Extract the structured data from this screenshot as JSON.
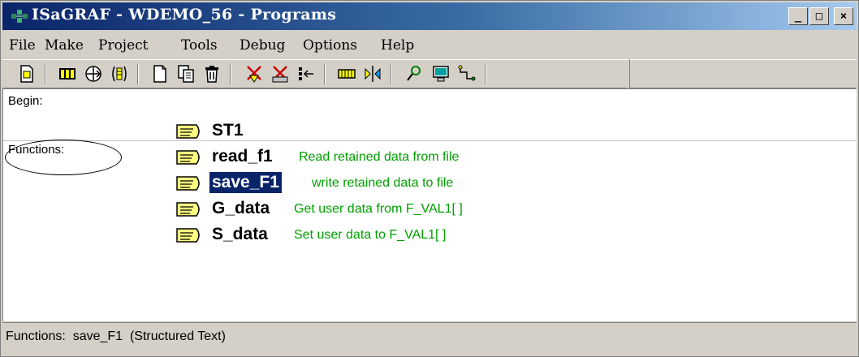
{
  "window": {
    "title": "ISaGRAF - WDEMO_56 - Programs",
    "minimize_glyph": "_",
    "maximize_glyph": "□",
    "close_glyph": "×"
  },
  "menu": [
    {
      "label": "File",
      "mnemonic": "F"
    },
    {
      "label": "Make",
      "mnemonic": "M"
    },
    {
      "label": "Project",
      "mnemonic": "P"
    },
    {
      "label": "Tools",
      "mnemonic": "T"
    },
    {
      "label": "Debug",
      "mnemonic": "b"
    },
    {
      "label": "Options",
      "mnemonic": "O"
    },
    {
      "label": "Help",
      "mnemonic": "H"
    }
  ],
  "toolbar": [
    {
      "icon": "properties-icon"
    },
    {
      "icon": "dictionary-icon"
    },
    {
      "icon": "io-connection-icon"
    },
    {
      "icon": "libraries-icon"
    },
    {
      "icon": "new-program-icon"
    },
    {
      "icon": "copy-program-icon"
    },
    {
      "icon": "delete-program-icon"
    },
    {
      "icon": "verify-icon"
    },
    {
      "icon": "compile-icon"
    },
    {
      "icon": "insert-icon"
    },
    {
      "icon": "memory-icon"
    },
    {
      "icon": "link-icon"
    },
    {
      "icon": "debug-icon"
    },
    {
      "icon": "simulate-icon"
    },
    {
      "icon": "connect-icon"
    }
  ],
  "sections": {
    "begin": {
      "label": "Begin:"
    },
    "functions": {
      "label": "Functions:"
    }
  },
  "programs": {
    "begin": [
      {
        "name": "ST1",
        "description": "",
        "selected": false
      }
    ],
    "functions": [
      {
        "name": "read_f1",
        "description": "Read retained data from file",
        "selected": false
      },
      {
        "name": "save_F1",
        "description": "write retained data to file",
        "selected": true
      },
      {
        "name": "G_data",
        "description": "Get user data from F_VAL1[ ]",
        "selected": false
      },
      {
        "name": "S_data",
        "description": "Set user data to F_VAL1[ ]",
        "selected": false
      }
    ]
  },
  "status": {
    "text": "Functions:  save_F1  (Structured Text)"
  },
  "colors": {
    "description_text": "#00a000",
    "selection_bg": "#0a246a",
    "title_gradient_start": "#0a246a",
    "title_gradient_end": "#a6caf0"
  }
}
